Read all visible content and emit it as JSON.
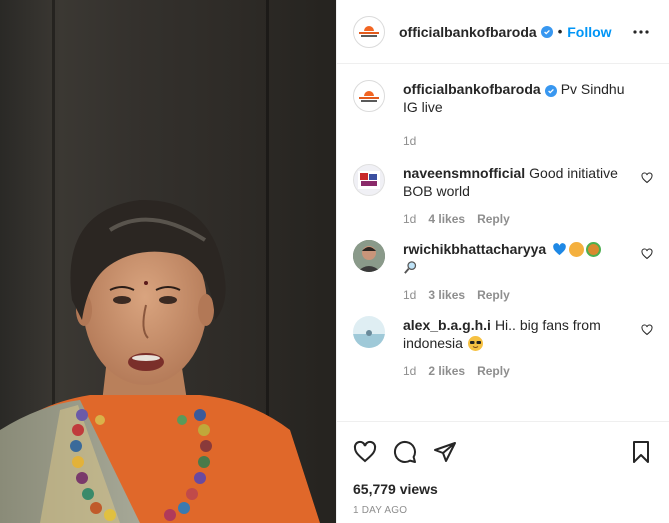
{
  "post": {
    "account": "officialbankofbaroda",
    "follow_label": "Follow",
    "separator": "•",
    "views": "65,779 views",
    "posted": "1 DAY AGO"
  },
  "caption": {
    "user": "officialbankofbaroda",
    "text": "Pv Sindhu IG live",
    "time": "1d"
  },
  "comments": [
    {
      "user": "naveensmnofficial",
      "text": "Good initiative BOB world",
      "time": "1d",
      "likes": "4 likes",
      "reply": "Reply"
    },
    {
      "user": "rwichikbhattacharyya",
      "text": "",
      "time": "1d",
      "likes": "3 likes",
      "reply": "Reply",
      "emojis": [
        "blue-heart",
        "woman-tipping-hand",
        "medal",
        "magnifier"
      ]
    },
    {
      "user": "alex_b.a.g.h.i",
      "text": "Hi.. big fans from indonesia",
      "time": "1d",
      "likes": "2 likes",
      "reply": "Reply",
      "emojis": [
        "sunglasses-face"
      ]
    }
  ],
  "icons": [
    "verified-badge-icon",
    "more-options-icon",
    "heart-icon",
    "comment-icon",
    "share-icon",
    "bookmark-icon"
  ],
  "colors": {
    "accent": "#0095f6",
    "verified": "#3897f0",
    "meta": "#8e8e8e",
    "text": "#262626"
  }
}
